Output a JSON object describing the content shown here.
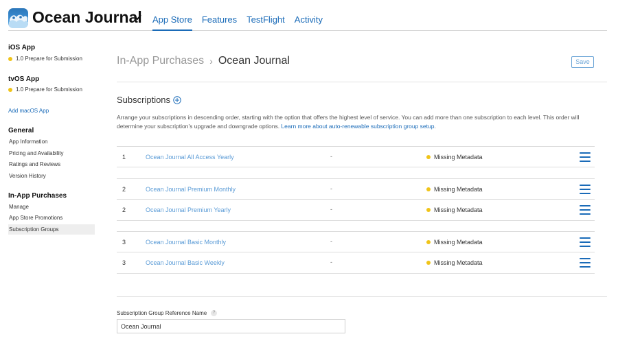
{
  "header": {
    "app_title": "Ocean Journal",
    "tabs": [
      {
        "label": "App Store",
        "active": true
      },
      {
        "label": "Features",
        "active": false
      },
      {
        "label": "TestFlight",
        "active": false
      },
      {
        "label": "Activity",
        "active": false
      }
    ]
  },
  "sidebar": {
    "ios": {
      "heading": "iOS App",
      "status": "1.0 Prepare for Submission"
    },
    "tvos": {
      "heading": "tvOS App",
      "status": "1.0 Prepare for Submission"
    },
    "add_macos": "Add macOS App",
    "general": {
      "heading": "General",
      "items": [
        "App Information",
        "Pricing and Availability",
        "Ratings and Reviews",
        "Version History"
      ]
    },
    "iap": {
      "heading": "In-App Purchases",
      "items": [
        "Manage",
        "App Store Promotions",
        "Subscription Groups"
      ],
      "selected": "Subscription Groups"
    }
  },
  "breadcrumb": {
    "parent": "In-App Purchases",
    "current": "Ocean Journal"
  },
  "save_label": "Save",
  "subscriptions": {
    "title": "Subscriptions",
    "description": "Arrange your subscriptions in descending order, starting with the option that offers the highest level of service. You can add more than one subscription to each level. This order will determine your subscription’s upgrade and downgrade options.",
    "learn_more": "Learn more about auto-renewable subscription group setup",
    "rows": [
      {
        "level": "1",
        "name": "Ocean Journal All Access Yearly",
        "dash": "-",
        "status": "Missing Metadata"
      },
      {
        "level": "2",
        "name": "Ocean Journal Premium Monthly",
        "dash": "-",
        "status": "Missing Metadata"
      },
      {
        "level": "2",
        "name": "Ocean Journal Premium Yearly",
        "dash": "-",
        "status": "Missing Metadata"
      },
      {
        "level": "3",
        "name": "Ocean Journal Basic Monthly",
        "dash": "-",
        "status": "Missing Metadata"
      },
      {
        "level": "3",
        "name": "Ocean Journal Basic Weekly",
        "dash": "-",
        "status": "Missing Metadata"
      }
    ]
  },
  "reference": {
    "label": "Subscription Group Reference Name",
    "help": "?",
    "value": "Ocean Journal"
  },
  "colors": {
    "accent": "#1a6bb8",
    "status_warning": "#f0c419",
    "link_light": "#5a9bd6"
  }
}
